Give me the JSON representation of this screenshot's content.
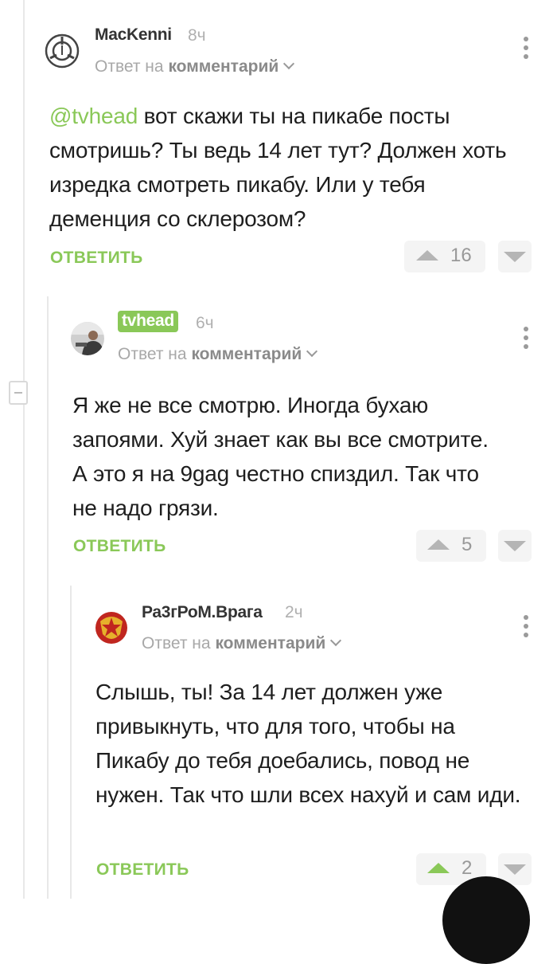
{
  "comments": [
    {
      "username": "MacKenni",
      "time": "8ч",
      "reply_prefix": "Ответ на",
      "reply_target": "комментарий",
      "text_mention": "@tvhead",
      "text": " вот скажи ты на пикабе посты смотришь? Ты ведь 14 лет тут? Должен хоть изредка смотреть пикабу. Или у тебя деменция со склерозом?",
      "reply_label": "ОТВЕТИТЬ",
      "rating": "16",
      "avatar_icon": "scp-logo-icon"
    },
    {
      "username": "tvhead",
      "time": "6ч",
      "reply_prefix": "Ответ на",
      "reply_target": "комментарий",
      "text": "Я же не все смотрю. Иногда бухаю запоями. Хуй знает как вы все смотрите. А это я на 9gag честно спиздил. Так что не надо грязи.",
      "reply_label": "ОТВЕТИТЬ",
      "rating": "5",
      "avatar_icon": "user-photo-avatar"
    },
    {
      "username": "Ра3гРоМ.Врага",
      "time": "2ч",
      "reply_prefix": "Ответ на",
      "reply_target": "комментарий",
      "text": "Слышь, ты! За 14 лет должен уже привыкнуть, что для того, чтобы на Пикабу до тебя доебались, повод не нужен. Так что шли всех нахуй и сам иди.",
      "reply_label": "ОТВЕТИТЬ",
      "rating": "2",
      "avatar_icon": "red-emblem-avatar"
    }
  ],
  "colors": {
    "accent_green": "#8ac858",
    "vote_inactive": "#b5b5b5"
  }
}
